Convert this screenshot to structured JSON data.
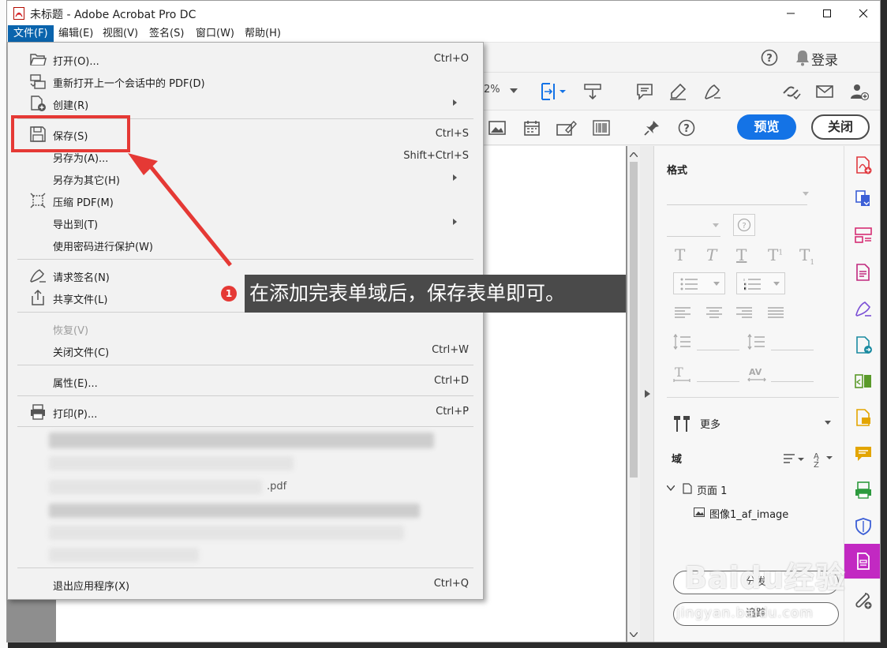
{
  "window": {
    "title": "未标题 - Adobe Acrobat Pro DC"
  },
  "menubar": [
    "文件(F)",
    "编辑(E)",
    "视图(V)",
    "签名(S)",
    "窗口(W)",
    "帮助(H)"
  ],
  "toprow": {
    "login": "登录"
  },
  "toolbar": {
    "zoom": "2%"
  },
  "formbar": {
    "preview": "预览",
    "close": "关闭"
  },
  "file_menu": {
    "open": {
      "label": "打开(O)...",
      "shortcut": "Ctrl+O"
    },
    "reopen": {
      "label": "重新打开上一个会话中的 PDF(D)"
    },
    "create": {
      "label": "创建(R)"
    },
    "save": {
      "label": "保存(S)",
      "shortcut": "Ctrl+S"
    },
    "save_as": {
      "label": "另存为(A)...",
      "shortcut": "Shift+Ctrl+S"
    },
    "save_other": {
      "label": "另存为其它(H)"
    },
    "compress": {
      "label": "压缩 PDF(M)"
    },
    "export": {
      "label": "导出到(T)"
    },
    "protect": {
      "label": "使用密码进行保护(W)"
    },
    "request_sign": {
      "label": "请求签名(N)"
    },
    "share": {
      "label": "共享文件(L)"
    },
    "revert": {
      "label": "恢复(V)"
    },
    "close_file": {
      "label": "关闭文件(C)",
      "shortcut": "Ctrl+W"
    },
    "properties": {
      "label": "属性(E)...",
      "shortcut": "Ctrl+D"
    },
    "print": {
      "label": "打印(P)...",
      "shortcut": "Ctrl+P"
    },
    "recent_fragment": ".pdf",
    "exit": {
      "label": "退出应用程序(X)",
      "shortcut": "Ctrl+Q"
    }
  },
  "callout": {
    "num": "1",
    "text": "在添加完表单域后，保存表单即可。"
  },
  "right_panel": {
    "format_title": "格式",
    "more": "更多",
    "fields_title": "域",
    "page_node": "页面 1",
    "image_field": "图像1_af_image",
    "btn_distribute": "分发",
    "btn_track": "追踪"
  },
  "watermark": {
    "main": "Baidu经验",
    "sub": "jingyan.baidu.com"
  },
  "colors": {
    "accent": "#1473e6",
    "menu_highlight": "#0a64ad",
    "annotation_red": "#e53935",
    "tool_active": "#c229c2"
  }
}
